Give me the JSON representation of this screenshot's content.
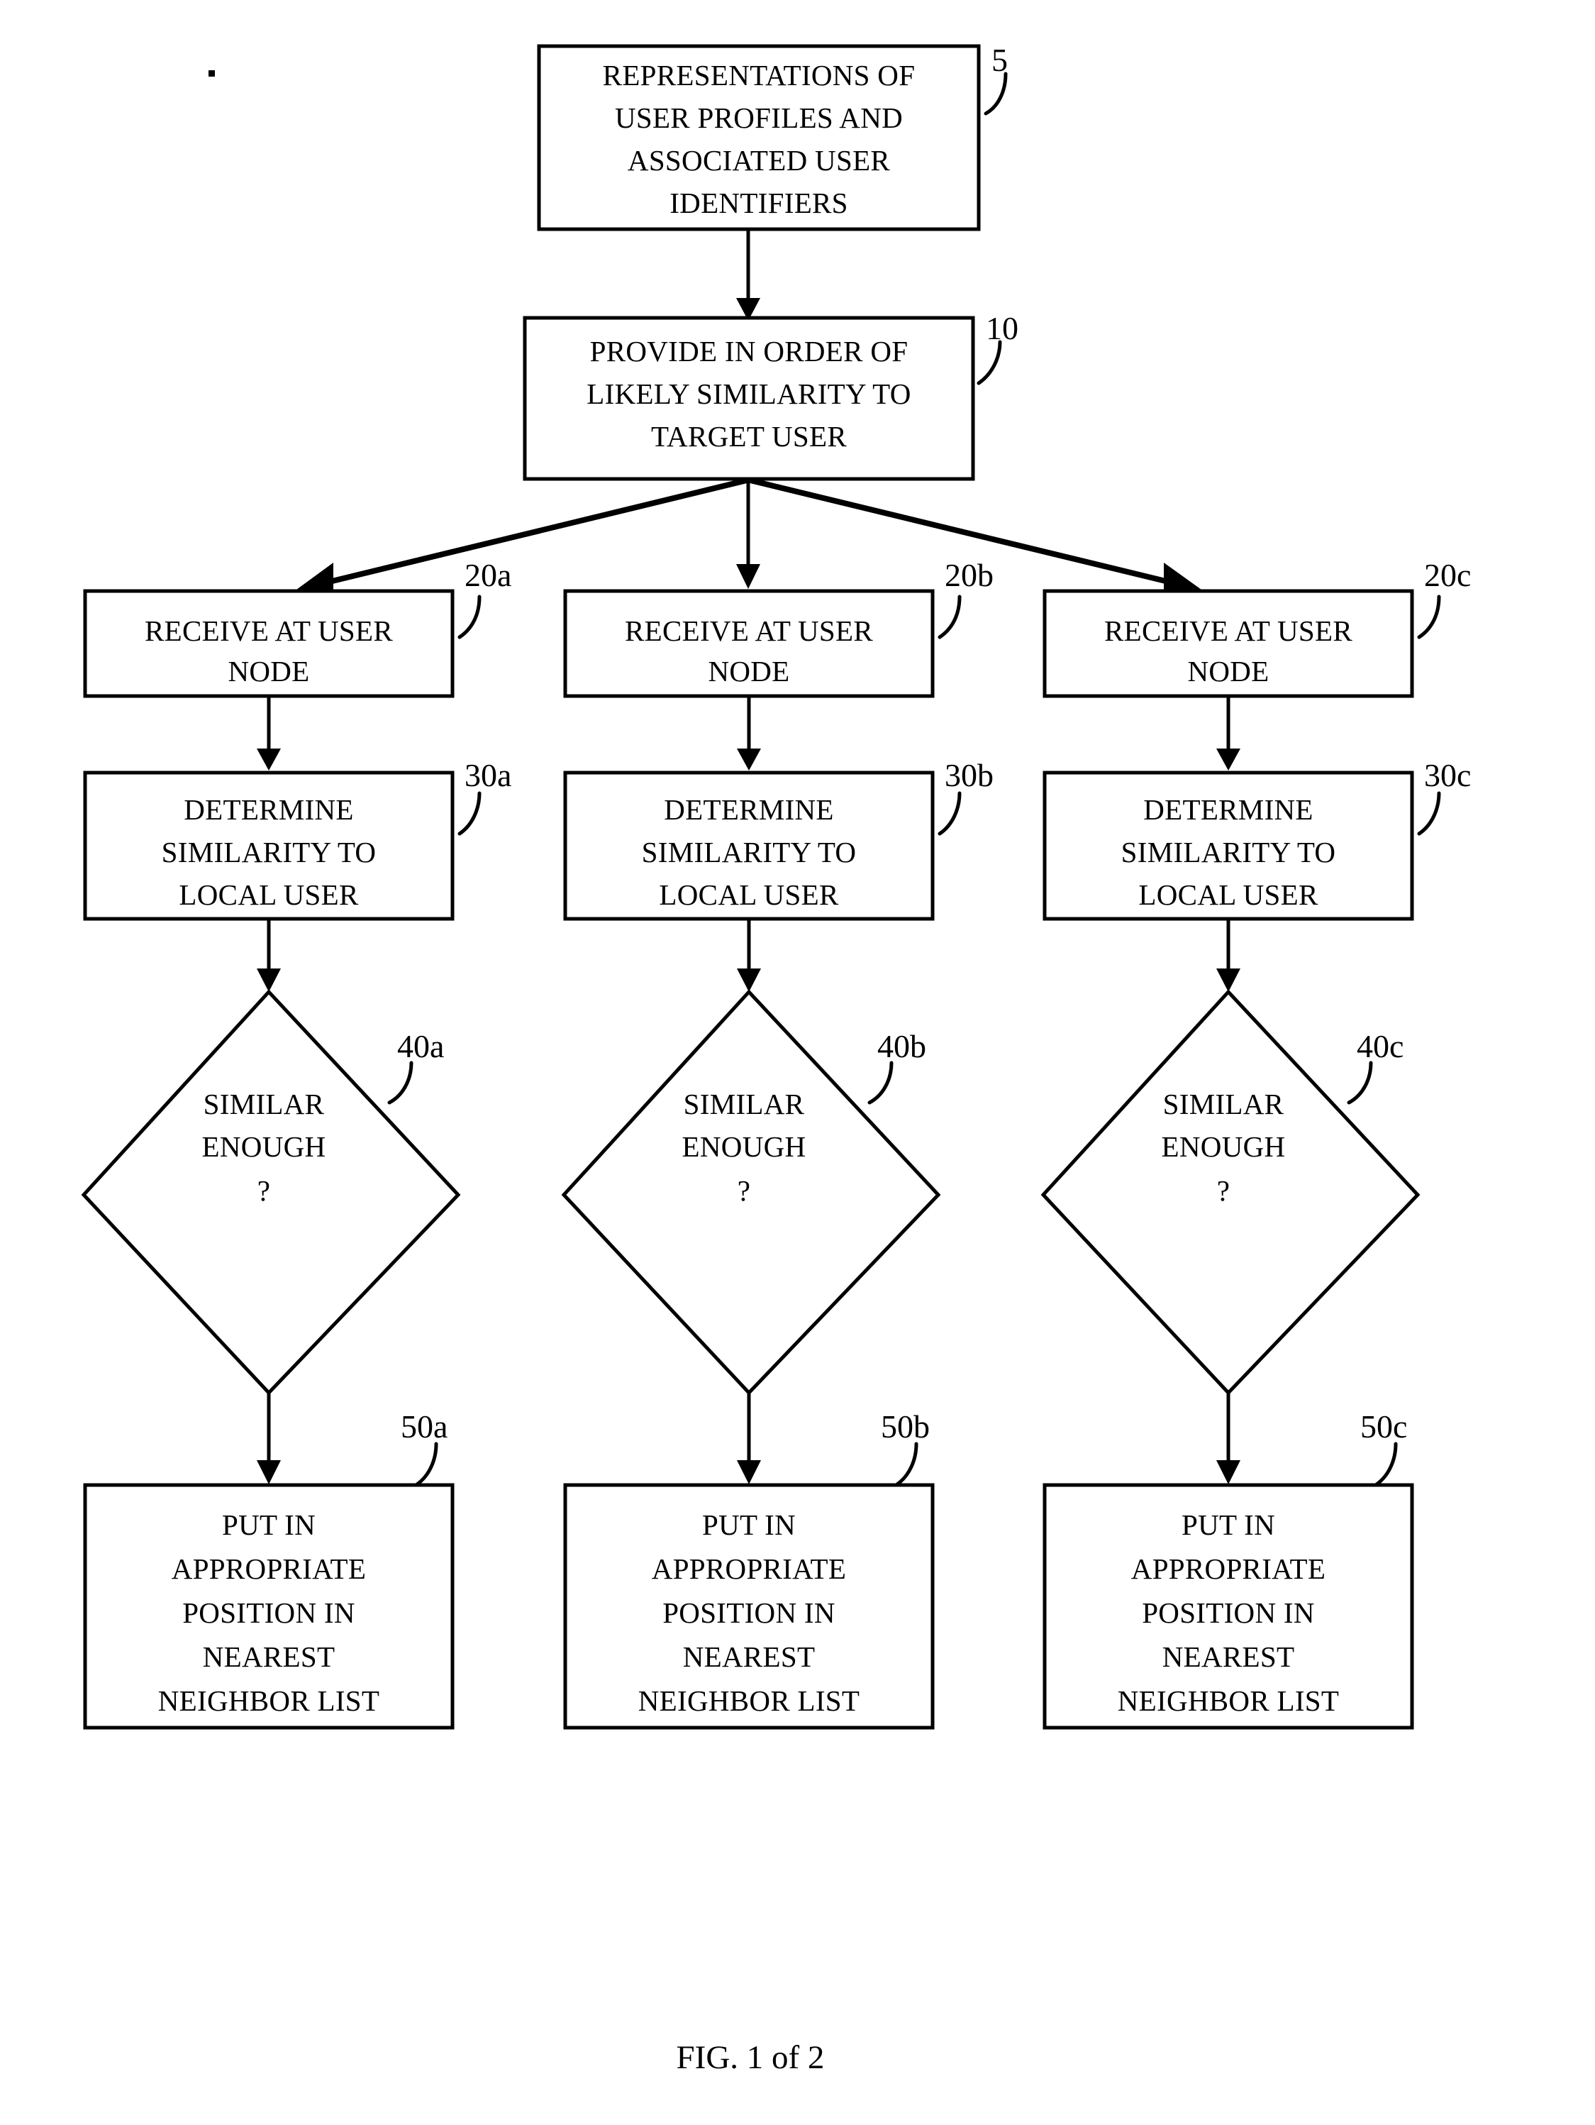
{
  "figure": {
    "caption": "FIG. 1 of 2",
    "type": "patent-flowchart"
  },
  "nodes": {
    "source": {
      "ref": "5",
      "shape": "rectangle",
      "lines": [
        "REPRESENTATIONS OF",
        "USER PROFILES AND",
        "ASSOCIATED USER",
        "IDENTIFIERS"
      ]
    },
    "provide": {
      "ref": "10",
      "shape": "rectangle",
      "lines": [
        "PROVIDE IN ORDER OF",
        "LIKELY SIMILARITY TO",
        "TARGET USER"
      ]
    },
    "receive_a": {
      "ref": "20a",
      "shape": "rectangle",
      "lines": [
        "RECEIVE AT USER",
        "NODE"
      ]
    },
    "receive_b": {
      "ref": "20b",
      "shape": "rectangle",
      "lines": [
        "RECEIVE AT USER",
        "NODE"
      ]
    },
    "receive_c": {
      "ref": "20c",
      "shape": "rectangle",
      "lines": [
        "RECEIVE AT USER",
        "NODE"
      ]
    },
    "determine_a": {
      "ref": "30a",
      "shape": "rectangle",
      "lines": [
        "DETERMINE",
        "SIMILARITY TO",
        "LOCAL USER"
      ]
    },
    "determine_b": {
      "ref": "30b",
      "shape": "rectangle",
      "lines": [
        "DETERMINE",
        "SIMILARITY TO",
        "LOCAL USER"
      ]
    },
    "determine_c": {
      "ref": "30c",
      "shape": "rectangle",
      "lines": [
        "DETERMINE",
        "SIMILARITY TO",
        "LOCAL USER"
      ]
    },
    "decision_a": {
      "ref": "40a",
      "shape": "diamond",
      "lines": [
        "SIMILAR",
        "ENOUGH",
        "?"
      ]
    },
    "decision_b": {
      "ref": "40b",
      "shape": "diamond",
      "lines": [
        "SIMILAR",
        "ENOUGH",
        "?"
      ]
    },
    "decision_c": {
      "ref": "40c",
      "shape": "diamond",
      "lines": [
        "SIMILAR",
        "ENOUGH",
        "?"
      ]
    },
    "put_a": {
      "ref": "50a",
      "shape": "rectangle",
      "lines": [
        "PUT IN",
        "APPROPRIATE",
        "POSITION IN",
        "NEAREST",
        "NEIGHBOR LIST"
      ]
    },
    "put_b": {
      "ref": "50b",
      "shape": "rectangle",
      "lines": [
        "PUT IN",
        "APPROPRIATE",
        "POSITION IN",
        "NEAREST",
        "NEIGHBOR LIST"
      ]
    },
    "put_c": {
      "ref": "50c",
      "shape": "rectangle",
      "lines": [
        "PUT IN",
        "APPROPRIATE",
        "POSITION IN",
        "NEAREST",
        "NEIGHBOR LIST"
      ]
    }
  },
  "colors": {
    "ink": "#000000",
    "paper": "#ffffff"
  }
}
